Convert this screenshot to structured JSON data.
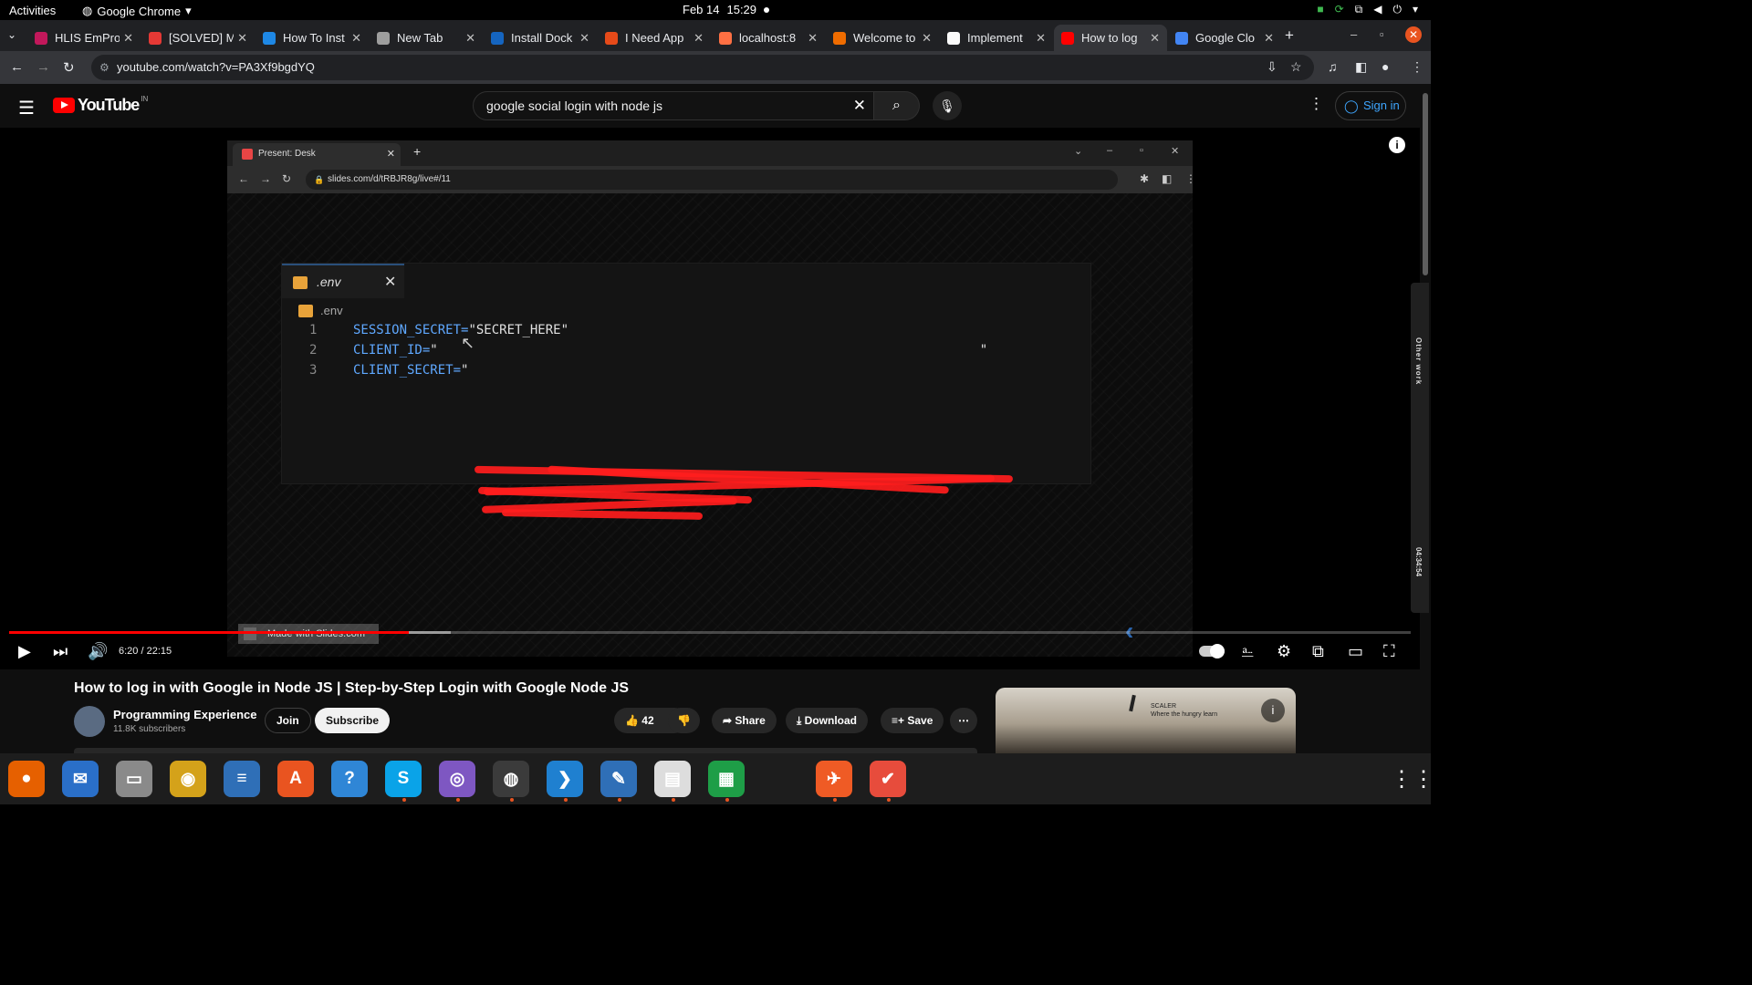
{
  "system": {
    "activities": "Activities",
    "app_menu": "Google Chrome",
    "date": "Feb 14",
    "time": "15:29"
  },
  "browser": {
    "tabs": [
      {
        "label": "HLIS EmPro",
        "color": "#c2185b",
        "active": false
      },
      {
        "label": "[SOLVED] M",
        "color": "#e53935",
        "active": false
      },
      {
        "label": "How To Inst",
        "color": "#1e88e5",
        "active": false
      },
      {
        "label": "New Tab",
        "color": "#9e9e9e",
        "active": false
      },
      {
        "label": "Install Dock",
        "color": "#1565c0",
        "active": false
      },
      {
        "label": "I Need App",
        "color": "#e64a19",
        "active": false
      },
      {
        "label": "localhost:8",
        "color": "#ff7043",
        "active": false
      },
      {
        "label": "Welcome to",
        "color": "#ef6c00",
        "active": false
      },
      {
        "label": "Implement",
        "color": "#fafafa",
        "active": false
      },
      {
        "label": "How to log",
        "color": "#ff0000",
        "active": true
      },
      {
        "label": "Google Clo",
        "color": "#4285f4",
        "active": false
      }
    ],
    "url": "youtube.com/watch?v=PA3Xf9bgdYQ"
  },
  "youtube": {
    "logo_text": "YouTube",
    "country": "IN",
    "search_query": "google social login with node js",
    "sign_in": "Sign in"
  },
  "video": {
    "inner_tab": "Present: Desk",
    "inner_url": "slides.com/d/tRBJR8g/live#/11",
    "editor_tab": ".env",
    "breadcrumb": ".env",
    "code": [
      {
        "n": "1",
        "key": "SESSION_SECRET=",
        "val": "\"SECRET_HERE\""
      },
      {
        "n": "2",
        "key": "CLIENT_ID=",
        "val": "\""
      },
      {
        "n": "3",
        "key": "CLIENT_SECRET=",
        "val": "\""
      }
    ],
    "code_line2_end": "\"",
    "watermark": "Made with Slides.com",
    "elapsed": "6:20",
    "duration": "22:15",
    "progress_fraction": 0.285,
    "buffered_fraction": 0.315,
    "side_panel_text": "Other work",
    "side_panel_time": "04:34:54"
  },
  "details": {
    "title": "How to log in with Google in Node JS | Step-by-Step Login with Google Node JS",
    "channel": "Programming Experience",
    "subscribers": "11.8K subscribers",
    "join": "Join",
    "subscribe": "Subscribe",
    "likes": "42",
    "share": "Share",
    "download": "Download",
    "save": "Save",
    "ad_brand": "SCALER",
    "ad_tagline": "Where the hungry learn"
  },
  "dock": [
    {
      "name": "firefox",
      "color": "#e66000",
      "glyph": "●",
      "running": false
    },
    {
      "name": "thunderbird",
      "color": "#2a6fc8",
      "glyph": "✉",
      "running": false
    },
    {
      "name": "files",
      "color": "#8a8a8a",
      "glyph": "▭",
      "running": false
    },
    {
      "name": "rhythmbox",
      "color": "#d4a21a",
      "glyph": "◉",
      "running": false
    },
    {
      "name": "libreoffice-writer",
      "color": "#2f6fb7",
      "glyph": "≡",
      "running": false
    },
    {
      "name": "app-center",
      "color": "#e95420",
      "glyph": "A",
      "running": false
    },
    {
      "name": "help",
      "color": "#2f86d6",
      "glyph": "?",
      "running": false
    },
    {
      "name": "skype",
      "color": "#0aa3e8",
      "glyph": "S",
      "running": true
    },
    {
      "name": "network-globe",
      "color": "#7e57c2",
      "glyph": "◎",
      "running": true
    },
    {
      "name": "chrome",
      "color": "#3b3b3b",
      "glyph": "◍",
      "running": true
    },
    {
      "name": "vscode",
      "color": "#1f80d0",
      "glyph": "❯",
      "running": true
    },
    {
      "name": "text-editor",
      "color": "#2f6fb7",
      "glyph": "✎",
      "running": true
    },
    {
      "name": "document-viewer",
      "color": "#dddddd",
      "glyph": "▤",
      "running": true
    },
    {
      "name": "spreadsheet",
      "color": "#1e9e47",
      "glyph": "▦",
      "running": true
    },
    {
      "name": "separator",
      "color": "#1d1d1d",
      "glyph": "",
      "running": true
    },
    {
      "name": "postman",
      "color": "#ef5b25",
      "glyph": "✈",
      "running": true
    },
    {
      "name": "task-app",
      "color": "#e74c3c",
      "glyph": "✔",
      "running": true
    }
  ]
}
